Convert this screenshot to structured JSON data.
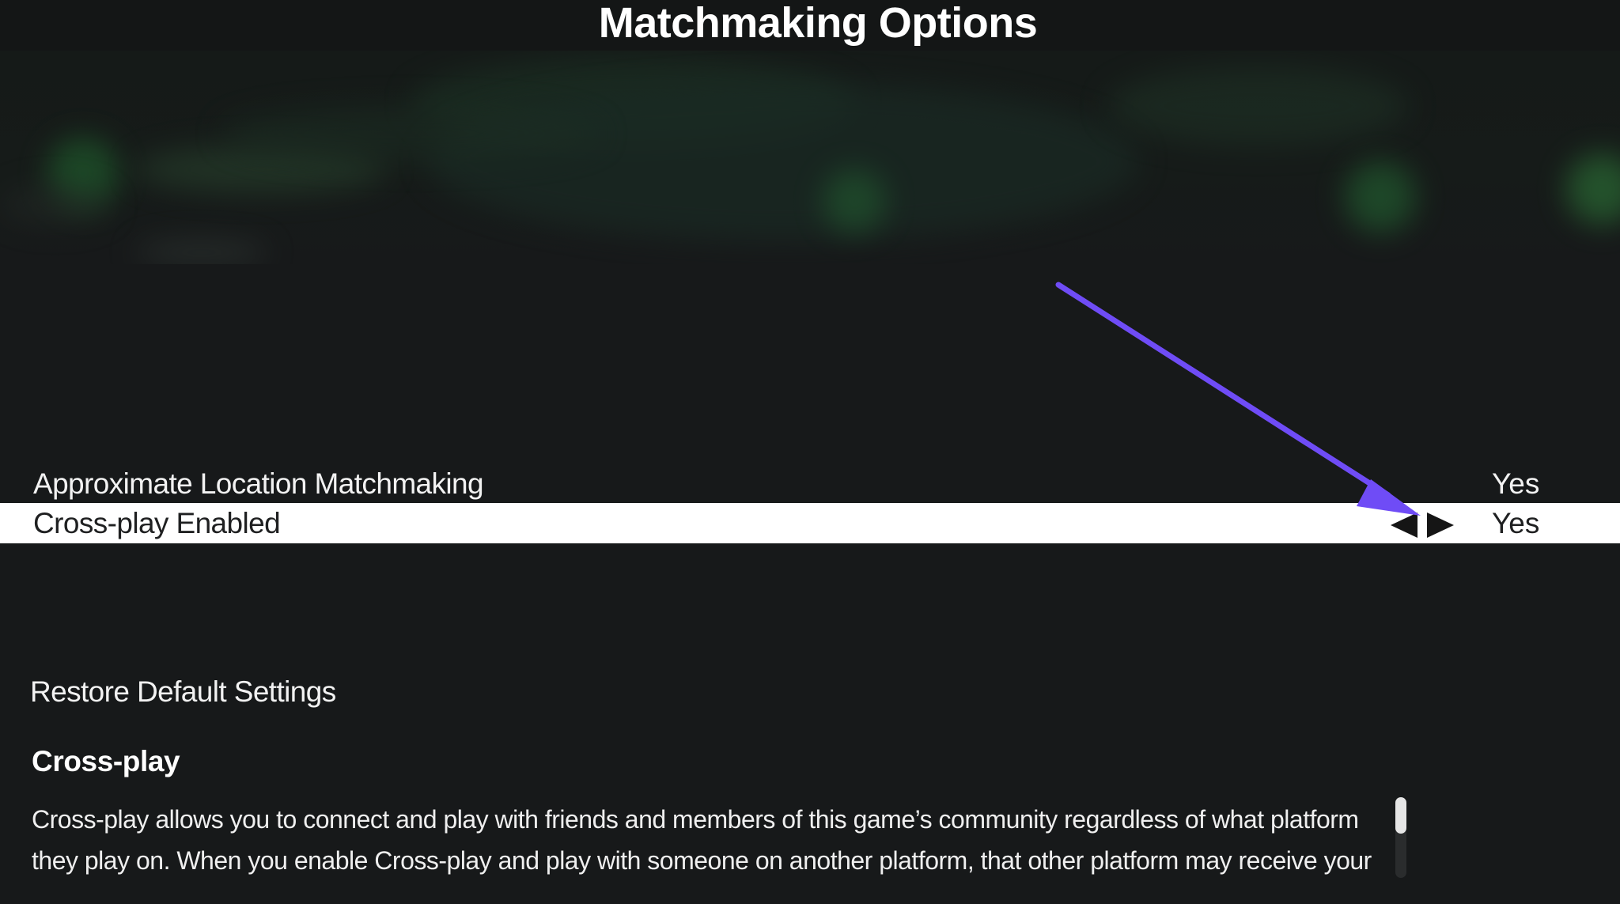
{
  "header": {
    "title": "Matchmaking Options"
  },
  "options": [
    {
      "label": "Approximate Location Matchmaking",
      "value": "Yes",
      "selected": false
    },
    {
      "label": "Cross-play Enabled",
      "value": "Yes",
      "selected": true
    }
  ],
  "restore": {
    "label": "Restore Default Settings"
  },
  "description": {
    "heading": "Cross-play",
    "body": "Cross-play allows you to connect and play with friends and members of this game’s community regardless of what platform they play on. When you enable Cross-play and play with someone on another platform, that other platform may receive your"
  },
  "icons": {
    "decrease": "arrow-left-icon",
    "increase": "arrow-right-icon"
  },
  "colors": {
    "background": "#17191a",
    "selected_row": "#ffffff",
    "annotation_arrow": "#6f4cf6"
  }
}
